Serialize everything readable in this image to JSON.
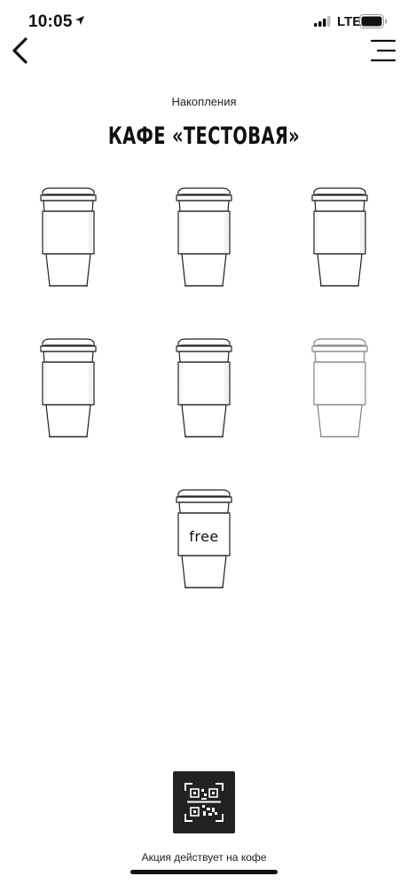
{
  "status_bar": {
    "time": "10:05",
    "network": "LTE",
    "icons": [
      "location-arrow-icon",
      "signal-bars-icon",
      "battery-icon"
    ]
  },
  "nav": {
    "back_icon": "chevron-left-icon",
    "menu_icon": "hamburger-menu-icon"
  },
  "header": {
    "subtitle": "Накопления",
    "title": "КАФЕ «ТЕСТОВАЯ»"
  },
  "stamps": {
    "total": 6,
    "filled": 5,
    "reward_label": "free"
  },
  "qr_button_icon": "qr-code-icon",
  "footer_text": "Акция действует на кофе"
}
